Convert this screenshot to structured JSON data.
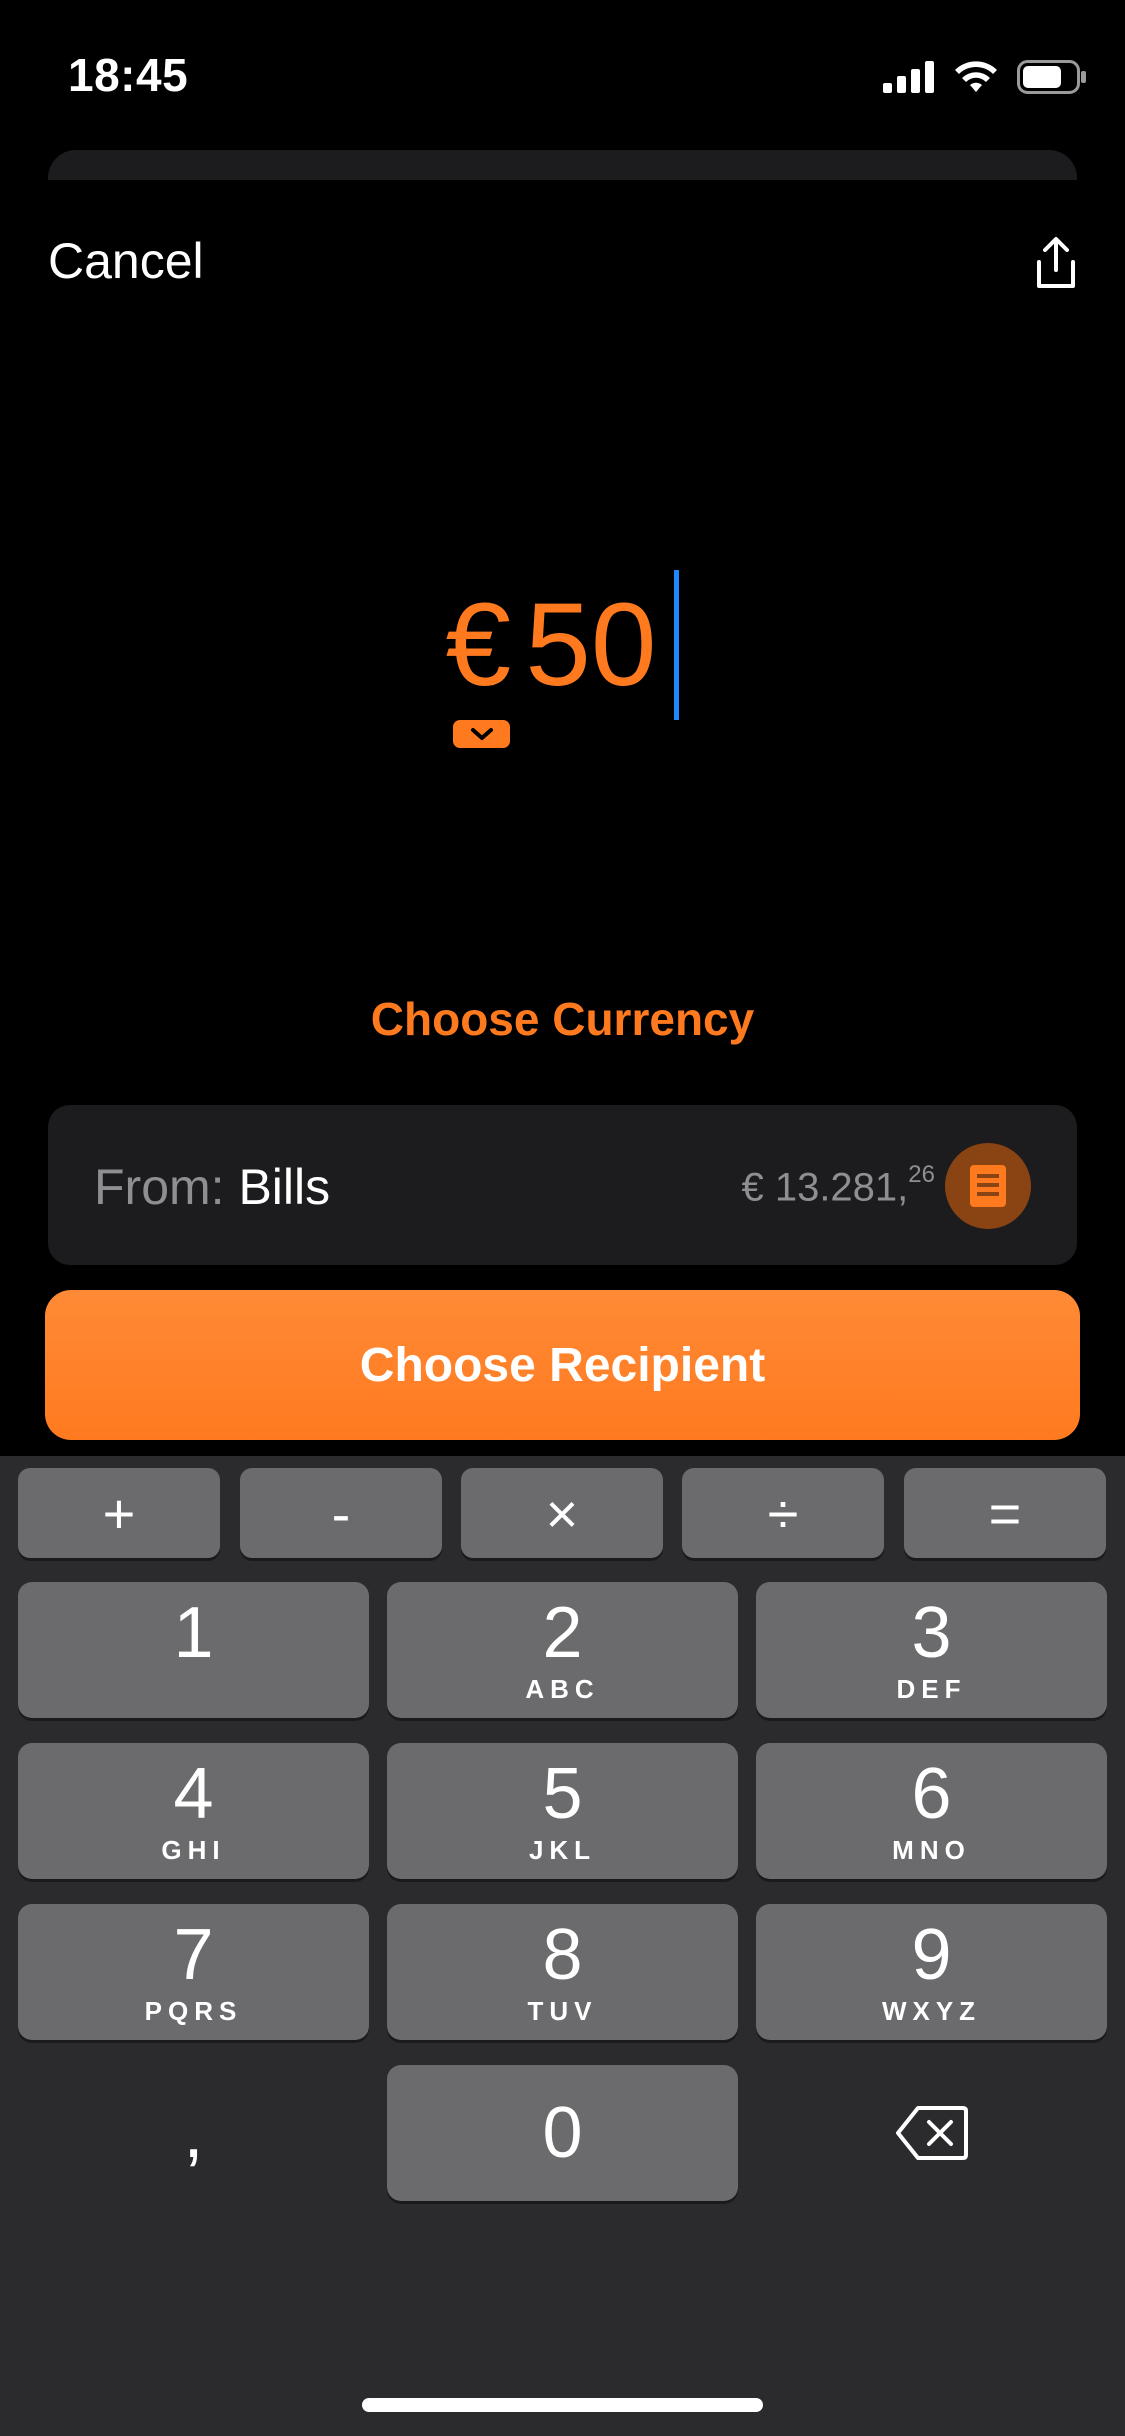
{
  "status_bar": {
    "time": "18:45"
  },
  "nav": {
    "cancel_label": "Cancel"
  },
  "amount": {
    "currency_symbol": "€",
    "value": "50"
  },
  "choose_currency_label": "Choose Currency",
  "from_account": {
    "prefix": "From:",
    "name": "Bills",
    "balance_main": "€ 13.281,",
    "balance_cents": "26"
  },
  "recipient_button_label": "Choose Recipient",
  "keyboard": {
    "operators": [
      "+",
      "-",
      "×",
      "÷",
      "="
    ],
    "keys": [
      {
        "digit": "1",
        "letters": ""
      },
      {
        "digit": "2",
        "letters": "ABC"
      },
      {
        "digit": "3",
        "letters": "DEF"
      },
      {
        "digit": "4",
        "letters": "GHI"
      },
      {
        "digit": "5",
        "letters": "JKL"
      },
      {
        "digit": "6",
        "letters": "MNO"
      },
      {
        "digit": "7",
        "letters": "PQRS"
      },
      {
        "digit": "8",
        "letters": "TUV"
      },
      {
        "digit": "9",
        "letters": "WXYZ"
      },
      {
        "digit": "0",
        "letters": ""
      }
    ],
    "decimal_separator": ","
  },
  "colors": {
    "accent": "#ff7a1f",
    "cursor": "#1e88ff",
    "keyboard_bg": "#2b2b2d",
    "key_bg": "#6b6b6d"
  }
}
